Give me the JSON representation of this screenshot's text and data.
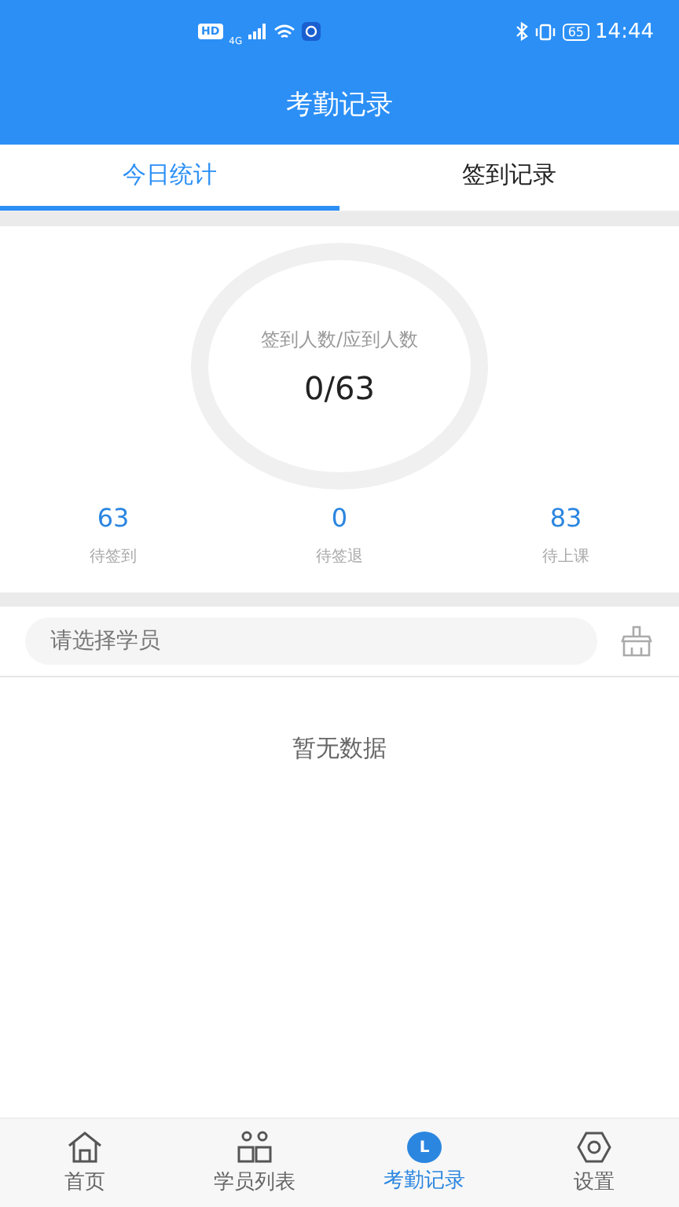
{
  "status_bar": {
    "hd": "HD",
    "network": "4G",
    "battery": "65",
    "time": "14:44"
  },
  "header": {
    "title": "考勤记录"
  },
  "tabs": [
    {
      "label": "今日统计",
      "selected": true
    },
    {
      "label": "签到记录",
      "selected": false
    }
  ],
  "summary": {
    "caption": "签到人数/应到人数",
    "value": "0/63"
  },
  "stats": [
    {
      "value": "63",
      "label": "待签到"
    },
    {
      "value": "0",
      "label": "待签退"
    },
    {
      "value": "83",
      "label": "待上课"
    }
  ],
  "search": {
    "placeholder": "请选择学员"
  },
  "empty_text": "暂无数据",
  "nav": [
    {
      "kind": "home",
      "label": "首页",
      "selected": false
    },
    {
      "kind": "students",
      "label": "学员列表",
      "selected": false
    },
    {
      "kind": "attendance",
      "label": "考勤记录",
      "selected": true,
      "badge": "L"
    },
    {
      "kind": "settings",
      "label": "设置",
      "selected": false
    }
  ]
}
